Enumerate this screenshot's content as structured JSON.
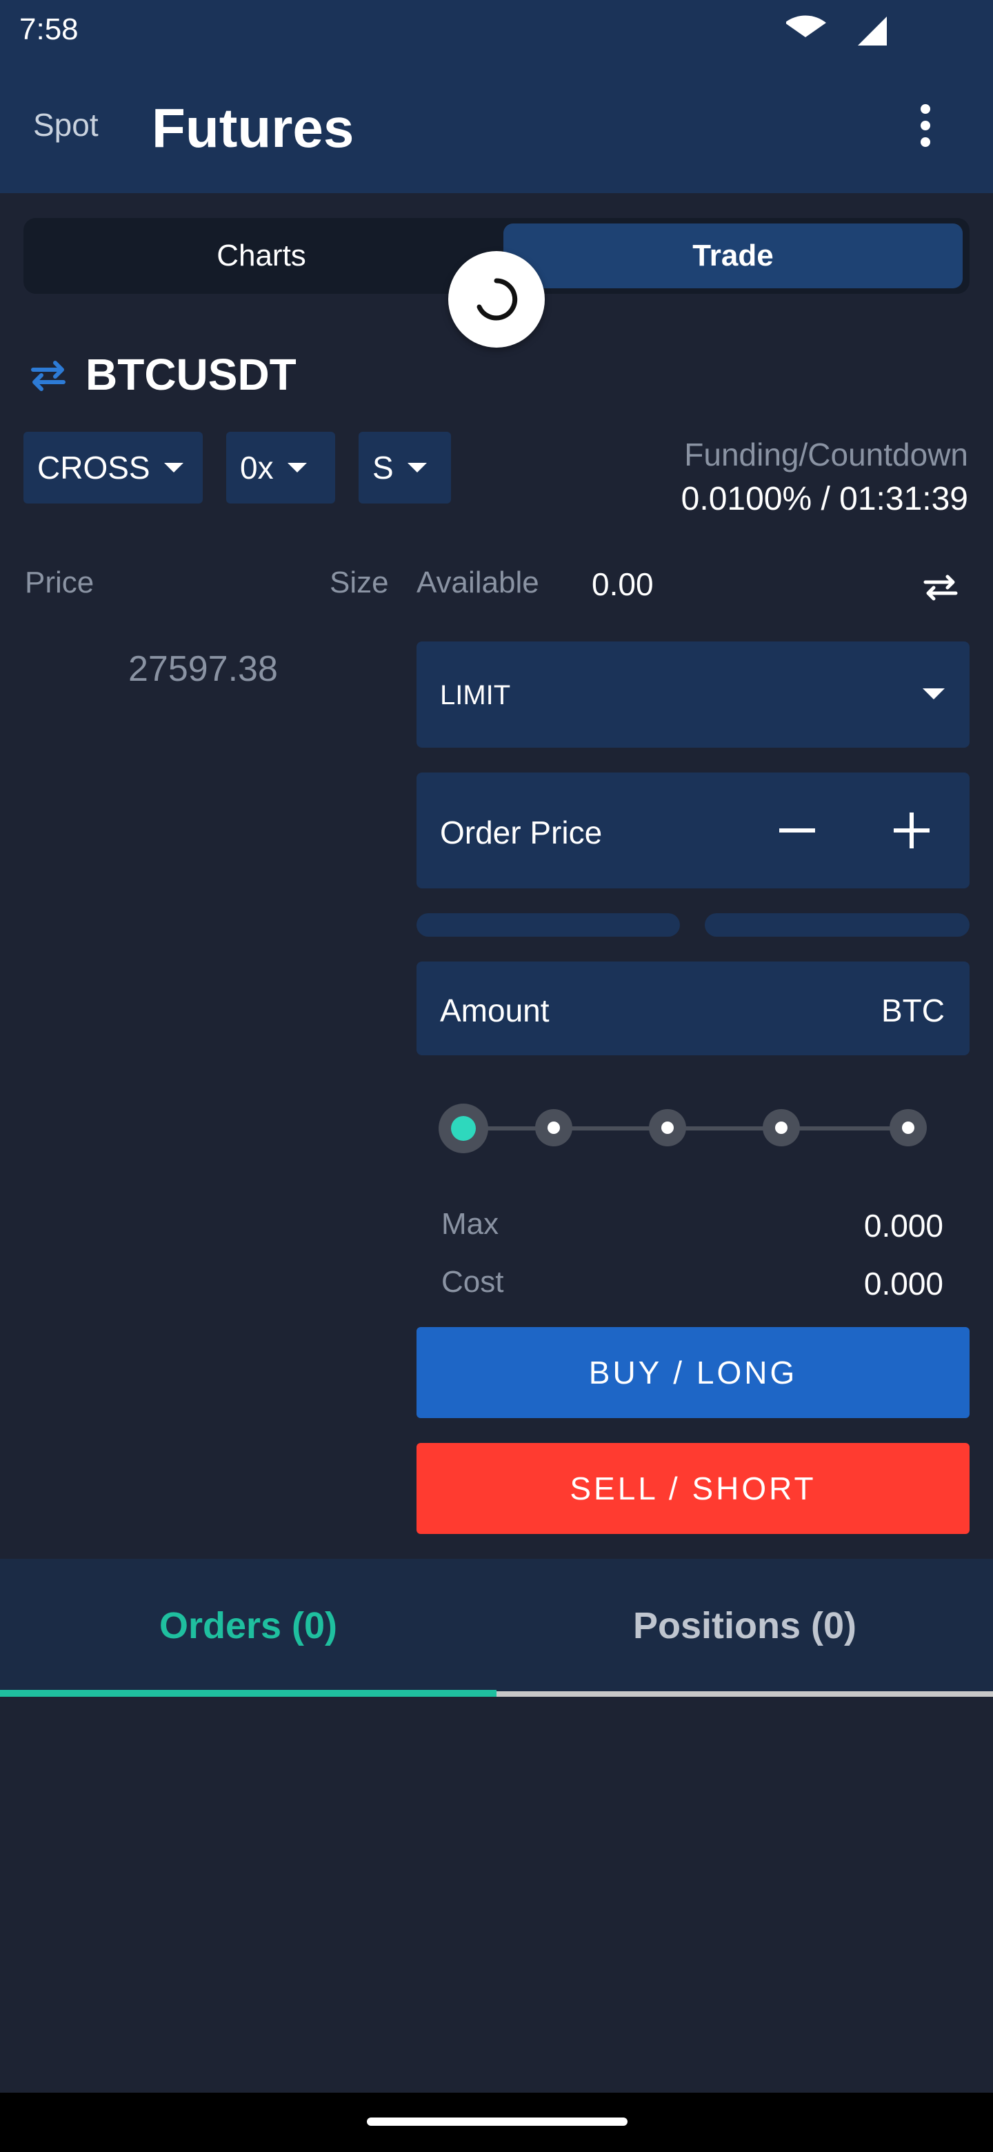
{
  "status_bar": {
    "time": "7:58"
  },
  "header": {
    "tab_spot": "Spot",
    "tab_futures": "Futures"
  },
  "segment": {
    "charts": "Charts",
    "trade": "Trade"
  },
  "symbol": "BTCUSDT",
  "dropdowns": {
    "margin_mode": "CROSS",
    "leverage": "0x",
    "side": "S"
  },
  "funding": {
    "label": "Funding/Countdown",
    "value": "0.0100% / 01:31:39"
  },
  "order_book": {
    "price_header": "Price",
    "size_header": "Size",
    "last_price": "27597.38"
  },
  "form": {
    "available_label": "Available",
    "available_value": "0.00",
    "order_type": "LIMIT",
    "order_price_label": "Order Price",
    "amount_label": "Amount",
    "amount_unit": "BTC",
    "max_label": "Max",
    "max_value": "0.000",
    "cost_label": "Cost",
    "cost_value": "0.000",
    "buy_label": "BUY / LONG",
    "sell_label": "SELL / SHORT",
    "amount_slider_percent": 0
  },
  "bottom_tabs": {
    "orders": "Orders (0)",
    "positions": "Positions (0)"
  },
  "colors": {
    "background": "#1d2333",
    "app_bar": "#1b3358",
    "accent_teal": "#1fbf9f",
    "buy_blue": "#1e66c6",
    "sell_red": "#ff3b30"
  }
}
